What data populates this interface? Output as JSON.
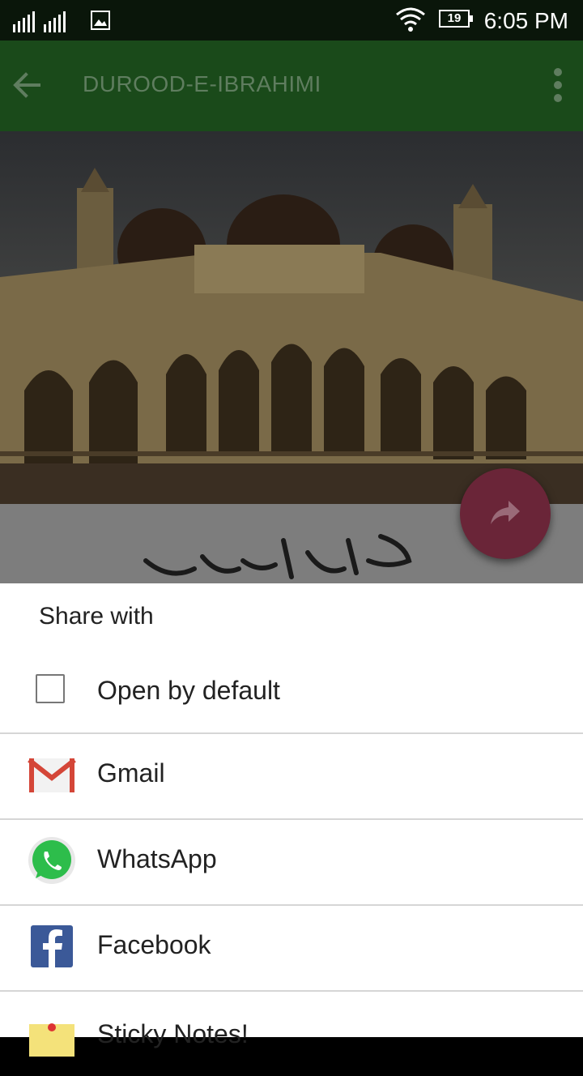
{
  "status_bar": {
    "time": "6:05 PM",
    "battery": "19"
  },
  "app_bar": {
    "title": "DUROOD-E-IBRAHIMI"
  },
  "share_sheet": {
    "heading": "Share with",
    "open_by_default_label": "Open by default",
    "apps": [
      {
        "label": "Gmail",
        "icon": "gmail-icon"
      },
      {
        "label": "WhatsApp",
        "icon": "whatsapp-icon"
      },
      {
        "label": "Facebook",
        "icon": "facebook-icon"
      },
      {
        "label": "Sticky Notes!",
        "icon": "sticky-notes-icon"
      }
    ]
  },
  "colors": {
    "app_bar": "#1a4a1a",
    "fab": "#6a2538",
    "status_bar": "#0a160a"
  }
}
